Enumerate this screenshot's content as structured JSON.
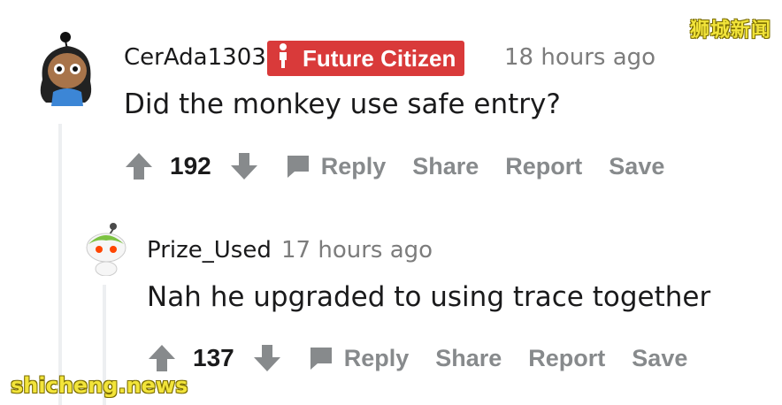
{
  "comments": [
    {
      "username": "CerAda1303",
      "flair": "Future Citizen",
      "flair_color": "#d93a3a",
      "timestamp": "18 hours ago",
      "body": "Did the monkey use safe entry?",
      "score": "192",
      "actions": {
        "reply": "Reply",
        "share": "Share",
        "report": "Report",
        "save": "Save"
      }
    },
    {
      "username": "Prize_Used",
      "timestamp": "17 hours ago",
      "body": "Nah he upgraded to using trace together",
      "score": "137",
      "actions": {
        "reply": "Reply",
        "share": "Share",
        "report": "Report",
        "save": "Save"
      }
    }
  ],
  "watermarks": {
    "top": "狮城新闻",
    "bottom": "shicheng.news"
  },
  "colors": {
    "muted": "#878a8c",
    "text": "#1a1a1b",
    "thread_line": "#edeff1"
  }
}
